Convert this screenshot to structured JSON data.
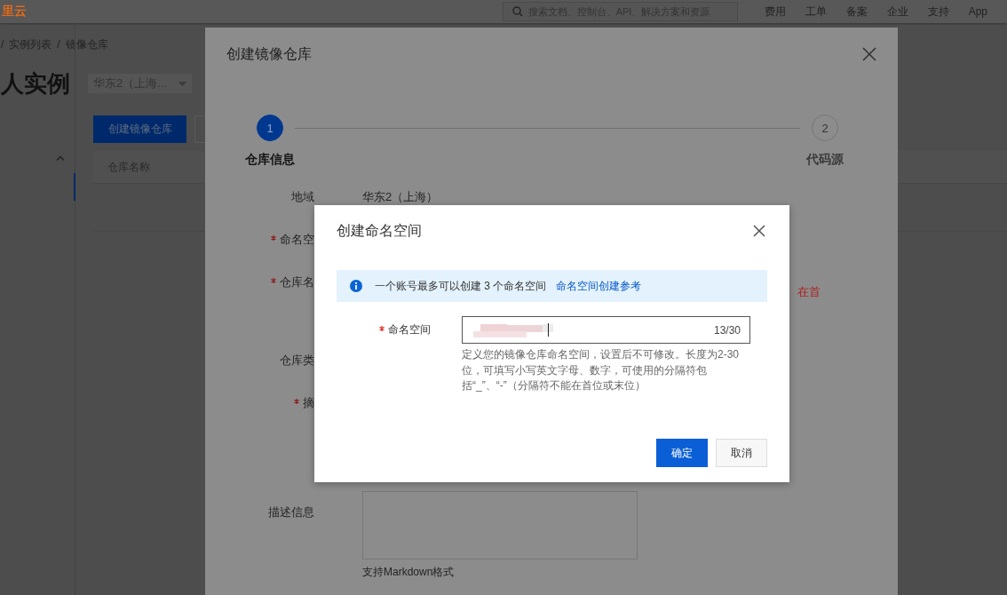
{
  "top_bar": {
    "logo": "里云",
    "search": {
      "placeholder": "搜索文档、控制台、API、解决方案和资源"
    },
    "nav": [
      "费用",
      "工单",
      "备案",
      "企业",
      "支持",
      "App"
    ]
  },
  "breadcrumb": [
    {
      "separator": "/",
      "label": "实例列表"
    },
    {
      "separator": "/",
      "label": "镜像仓库"
    }
  ],
  "page": {
    "title": "人实例",
    "region_select": "华东2（上海..."
  },
  "toolbar": {
    "create_button": "创建镜像仓库"
  },
  "table": {
    "columns": [
      "仓库名称"
    ]
  },
  "drawer": {
    "title": "创建镜像仓库",
    "steps": [
      {
        "number": "1",
        "label": "仓库信息",
        "selected": true
      },
      {
        "number": "2",
        "label": "代码源",
        "selected": false
      }
    ],
    "fields": [
      {
        "label": "地域",
        "required": false,
        "kind": "text",
        "value": "华东2（上海）"
      },
      {
        "label": "命名空",
        "required": true,
        "kind": "covered"
      },
      {
        "label": "仓库名",
        "required": true,
        "kind": "covered",
        "error": "在首"
      },
      {
        "label": "仓库类",
        "required": false,
        "kind": "covered"
      },
      {
        "label": "摘",
        "required": true,
        "kind": "covered"
      },
      {
        "label": "描述信息",
        "required": false,
        "kind": "textarea",
        "hint": "支持Markdown格式"
      }
    ]
  },
  "modal": {
    "title": "创建命名空间",
    "alert": {
      "text": "一个账号最多可以创建 3 个命名空间",
      "link": "命名空间创建参考"
    },
    "field": {
      "label": "命名空间",
      "required": true,
      "counter": "13/30",
      "help": "定义您的镜像仓库命名空间，设置后不可修改。长度为2-30位，可填写小写英文字母、数字，可使用的分隔符包括“_”、“-”（分隔符不能在首位或末位）"
    },
    "buttons": [
      {
        "label": "确定",
        "kind": "primary"
      },
      {
        "label": "取消",
        "kind": "default"
      }
    ]
  }
}
